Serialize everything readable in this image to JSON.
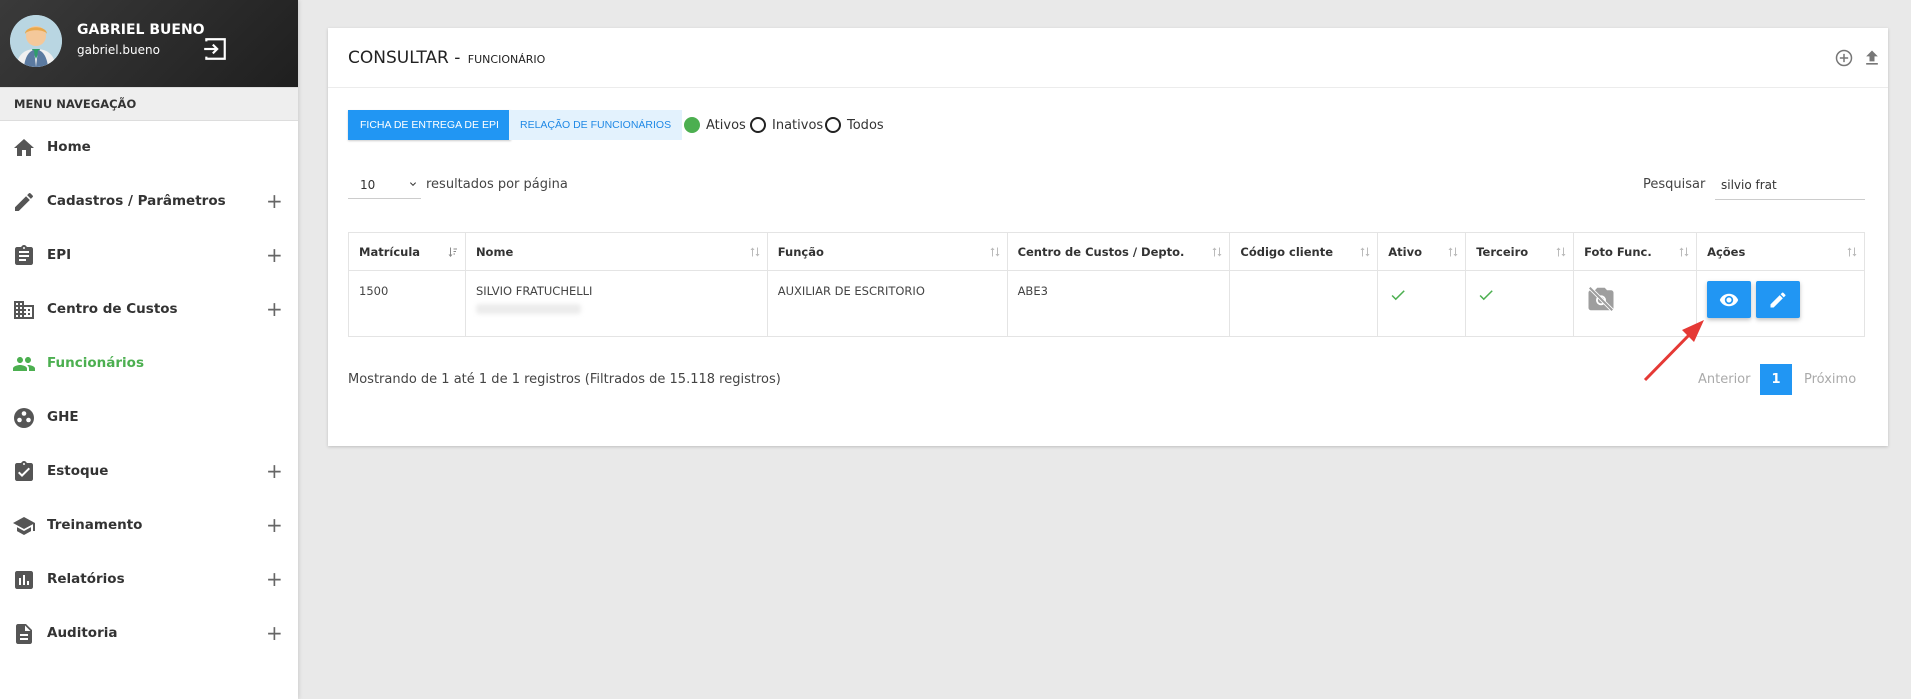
{
  "user": {
    "name": "GABRIEL BUENO",
    "login": "gabriel.bueno"
  },
  "menu": {
    "header": "MENU NAVEGAÇÃO",
    "items": [
      {
        "label": "Home",
        "icon": "home-icon",
        "expandable": false
      },
      {
        "label": "Cadastros / Parâmetros",
        "icon": "pencil-icon",
        "expandable": true
      },
      {
        "label": "EPI",
        "icon": "clipboard-icon",
        "expandable": true
      },
      {
        "label": "Centro de Custos",
        "icon": "building-icon",
        "expandable": true
      },
      {
        "label": "Funcionários",
        "icon": "people-icon",
        "expandable": false,
        "active": true
      },
      {
        "label": "GHE",
        "icon": "group-icon",
        "expandable": false
      },
      {
        "label": "Estoque",
        "icon": "clipboard-check-icon",
        "expandable": true
      },
      {
        "label": "Treinamento",
        "icon": "school-icon",
        "expandable": true
      },
      {
        "label": "Relatórios",
        "icon": "chart-icon",
        "expandable": true
      },
      {
        "label": "Auditoria",
        "icon": "document-icon",
        "expandable": true
      }
    ],
    "plus": "+"
  },
  "card": {
    "title": "CONSULTAR",
    "separator": " - ",
    "subtitle": "FUNCIONÁRIO"
  },
  "toolbar": {
    "ficha_label": "FICHA DE ENTREGA DE EPI",
    "relacao_label": "RELAÇÃO DE FUNCIONÁRIOS",
    "filters": [
      {
        "label": "Ativos",
        "checked": true
      },
      {
        "label": "Inativos",
        "checked": false
      },
      {
        "label": "Todos",
        "checked": false
      }
    ]
  },
  "table_controls": {
    "page_length": "10",
    "page_length_label": "resultados por página",
    "search_label": "Pesquisar",
    "search_value": "silvio frat"
  },
  "table": {
    "columns": [
      "Matrícula",
      "Nome",
      "Função",
      "Centro de Custos / Depto.",
      "Código cliente",
      "Ativo",
      "Terceiro",
      "Foto Func.",
      "Ações"
    ],
    "rows": [
      {
        "matricula": "1500",
        "nome": "SILVIO FRATUCHELLI",
        "funcao": "AUXILIAR DE ESCRITORIO",
        "centro": "ABE3",
        "codigo": "",
        "ativo": true,
        "terceiro": true
      }
    ]
  },
  "footer": {
    "info": "Mostrando de 1 até 1 de 1 registros (Filtrados de 15.118 registros)",
    "prev": "Anterior",
    "page": "1",
    "next": "Próximo"
  },
  "colors": {
    "primary": "#2196f3",
    "active": "#4caf50",
    "header_dark": "#2b2b2b",
    "annotation": "#e53935"
  }
}
